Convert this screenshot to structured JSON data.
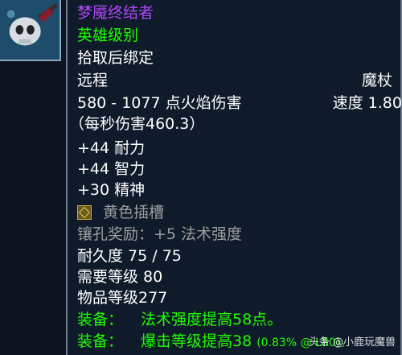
{
  "item": {
    "name": "梦魇终结者",
    "quality": "英雄级别",
    "binding": "拾取后绑定",
    "slot": "远程",
    "type": "魔杖",
    "damage": "580 - 1077 点火焰伤害",
    "speed": "速度 1.80",
    "dps": "（每秒伤害460.3）",
    "stats": [
      "+44 耐力",
      "+44 智力",
      "+30 精神"
    ],
    "socket": "黄色插槽",
    "socket_bonus": "镶孔奖励：+5 法术强度",
    "durability": "耐久度 75 / 75",
    "required_level": "需要等级 80",
    "item_level": "物品等级277",
    "equip_effects": [
      {
        "prefix": "装备：",
        "text": "法术强度提高58点。"
      },
      {
        "prefix": "装备：",
        "text": "爆击等级提高38",
        "extra": "(0.83% @ L80)。"
      }
    ]
  },
  "watermark": "头条 @小鹿玩魔兽",
  "colors": {
    "epic_purple": "#b048f8",
    "uncommon_green": "#1eff00",
    "gray": "#9d9d9d",
    "white": "#ffffff",
    "background": "#0f1a2b"
  },
  "icons": {
    "item_icon": "skull-wand-icon",
    "socket_icon": "yellow-socket-icon"
  }
}
